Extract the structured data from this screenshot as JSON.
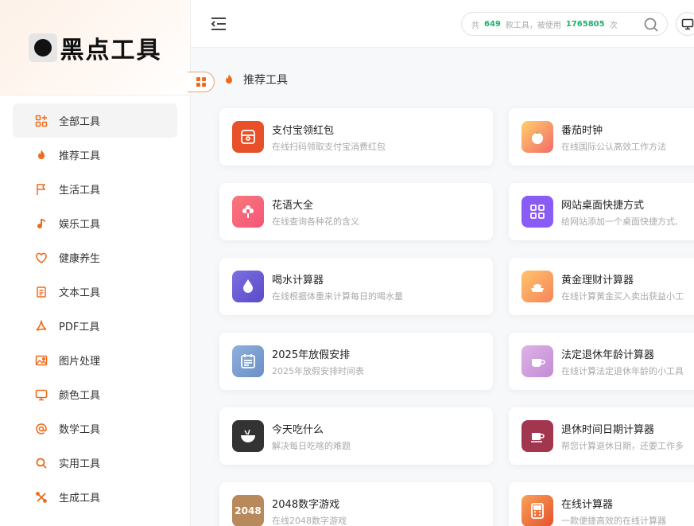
{
  "logo": {
    "text": "黑点工具"
  },
  "sidebar": {
    "items": [
      {
        "label": "全部工具",
        "icon": "apps-icon",
        "active": true
      },
      {
        "label": "推荐工具",
        "icon": "flame-icon",
        "active": false
      },
      {
        "label": "生活工具",
        "icon": "flag-icon",
        "active": false
      },
      {
        "label": "娱乐工具",
        "icon": "music-note-icon",
        "active": false
      },
      {
        "label": "健康养生",
        "icon": "heart-icon",
        "active": false
      },
      {
        "label": "文本工具",
        "icon": "document-icon",
        "active": false
      },
      {
        "label": "PDF工具",
        "icon": "pdf-icon",
        "active": false
      },
      {
        "label": "图片处理",
        "icon": "image-icon",
        "active": false
      },
      {
        "label": "颜色工具",
        "icon": "monitor-icon",
        "active": false
      },
      {
        "label": "数学工具",
        "icon": "at-sign-icon",
        "active": false
      },
      {
        "label": "实用工具",
        "icon": "magnify-icon",
        "active": false
      },
      {
        "label": "生成工具",
        "icon": "tools-icon",
        "active": false
      }
    ]
  },
  "header": {
    "search": {
      "prefix": "共",
      "tool_count": "649",
      "middle": "款工具，被使用",
      "use_count": "1765805",
      "suffix": "次"
    }
  },
  "main": {
    "section_title": "推荐工具",
    "cards": [
      {
        "title": "支付宝领红包",
        "desc": "在线扫码领取支付宝消费红包",
        "icon": "red-packet-icon",
        "color": "#e8502a"
      },
      {
        "title": "番茄时钟",
        "desc": "在线国际公认高效工作方法",
        "icon": "tomato-icon",
        "color": "#f6a04d"
      },
      {
        "title": "花语大全",
        "desc": "在线查询各种花的含义",
        "icon": "flower-icon",
        "color": "#f0657a"
      },
      {
        "title": "网站桌面快捷方式",
        "desc": "给网站添加一个桌面快捷方式,",
        "icon": "grid-apps-icon",
        "color": "#8a5cf6"
      },
      {
        "title": "喝水计算器",
        "desc": "在线根据体重来计算每日的喝水量",
        "icon": "water-drop-icon",
        "color": "#6a5bd8"
      },
      {
        "title": "黄金理财计算器",
        "desc": "在线计算黄金买入卖出获益小工",
        "icon": "gold-ingot-icon",
        "color": "#f7a25a"
      },
      {
        "title": "2025年放假安排",
        "desc": "2025年放假安排时间表",
        "icon": "calendar-icon",
        "color": "#6b8fc6"
      },
      {
        "title": "法定退休年龄计算器",
        "desc": "在线计算法定退休年龄的小工具",
        "icon": "coffee-cup-icon",
        "color": "#c99ad8"
      },
      {
        "title": "今天吃什么",
        "desc": "解决每日吃啥的难题",
        "icon": "bowl-icon",
        "color": "#333333"
      },
      {
        "title": "退休时间日期计算器",
        "desc": "帮您计算退休日期，还要工作多",
        "icon": "mug-icon",
        "color": "#a3364f"
      },
      {
        "title": "2048数字游戏",
        "desc": "在线2048数字游戏",
        "icon": "2048-icon",
        "color": "#b8895a",
        "badge": "2048"
      },
      {
        "title": "在线计算器",
        "desc": "一款便捷高效的在线计算器",
        "icon": "calculator-icon",
        "color": "#e8502a"
      }
    ]
  }
}
